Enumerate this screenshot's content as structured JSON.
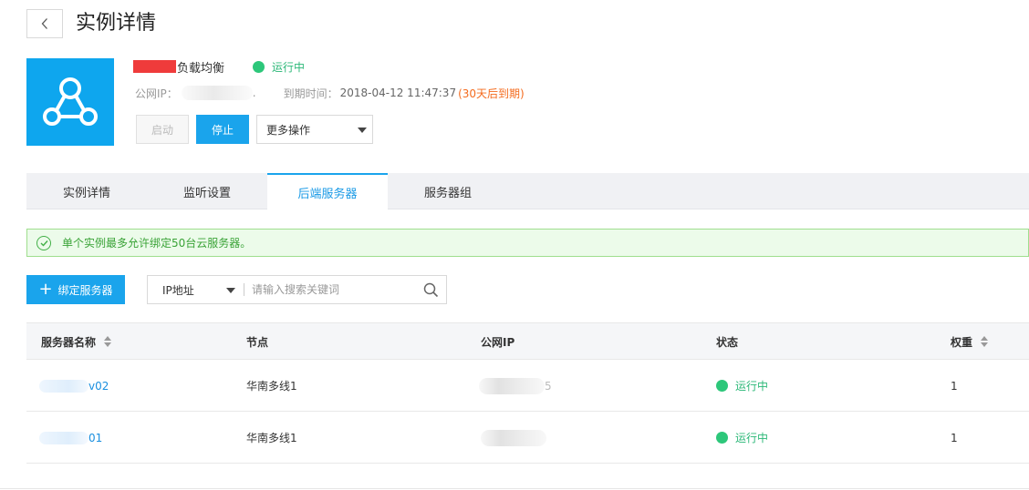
{
  "header": {
    "back_icon": "chevron-left-icon",
    "title": "实例详情"
  },
  "instance": {
    "logo_icon": "load-balancer-icon",
    "name_suffix": "负载均衡",
    "status": "运行中",
    "ip_label": "公网IP：",
    "ip_trailing": ".",
    "expire_label": "到期时间：",
    "expire_value": "2018-04-12 11:47:37",
    "expire_warning": "(30天后到期)"
  },
  "actions": {
    "start_label": "启动",
    "stop_label": "停止",
    "more_label": "更多操作"
  },
  "tabs": [
    {
      "label": "实例详情",
      "active": false
    },
    {
      "label": "监听设置",
      "active": false
    },
    {
      "label": "后端服务器",
      "active": true
    },
    {
      "label": "服务器组",
      "active": false
    }
  ],
  "alert": {
    "icon": "check-circle-icon",
    "message": "单个实例最多允许绑定50台云服务器。"
  },
  "toolbar": {
    "bind_label": "绑定服务器",
    "search_type": "IP地址",
    "search_placeholder": "请输入搜索关键词"
  },
  "table": {
    "columns": [
      "服务器名称",
      "节点",
      "公网IP",
      "状态",
      "权重"
    ],
    "rows": [
      {
        "name_suffix": "v02",
        "node": "华南多线1",
        "ip_trailing": "5",
        "status": "运行中",
        "weight": "1"
      },
      {
        "name_suffix": "01",
        "node": "华南多线1",
        "ip_trailing": "",
        "status": "运行中",
        "weight": "1"
      }
    ]
  },
  "colors": {
    "primary": "#1aa4ec",
    "success": "#2dc77a",
    "warning": "#f46b1e",
    "alert_bg": "#ecfbea"
  }
}
